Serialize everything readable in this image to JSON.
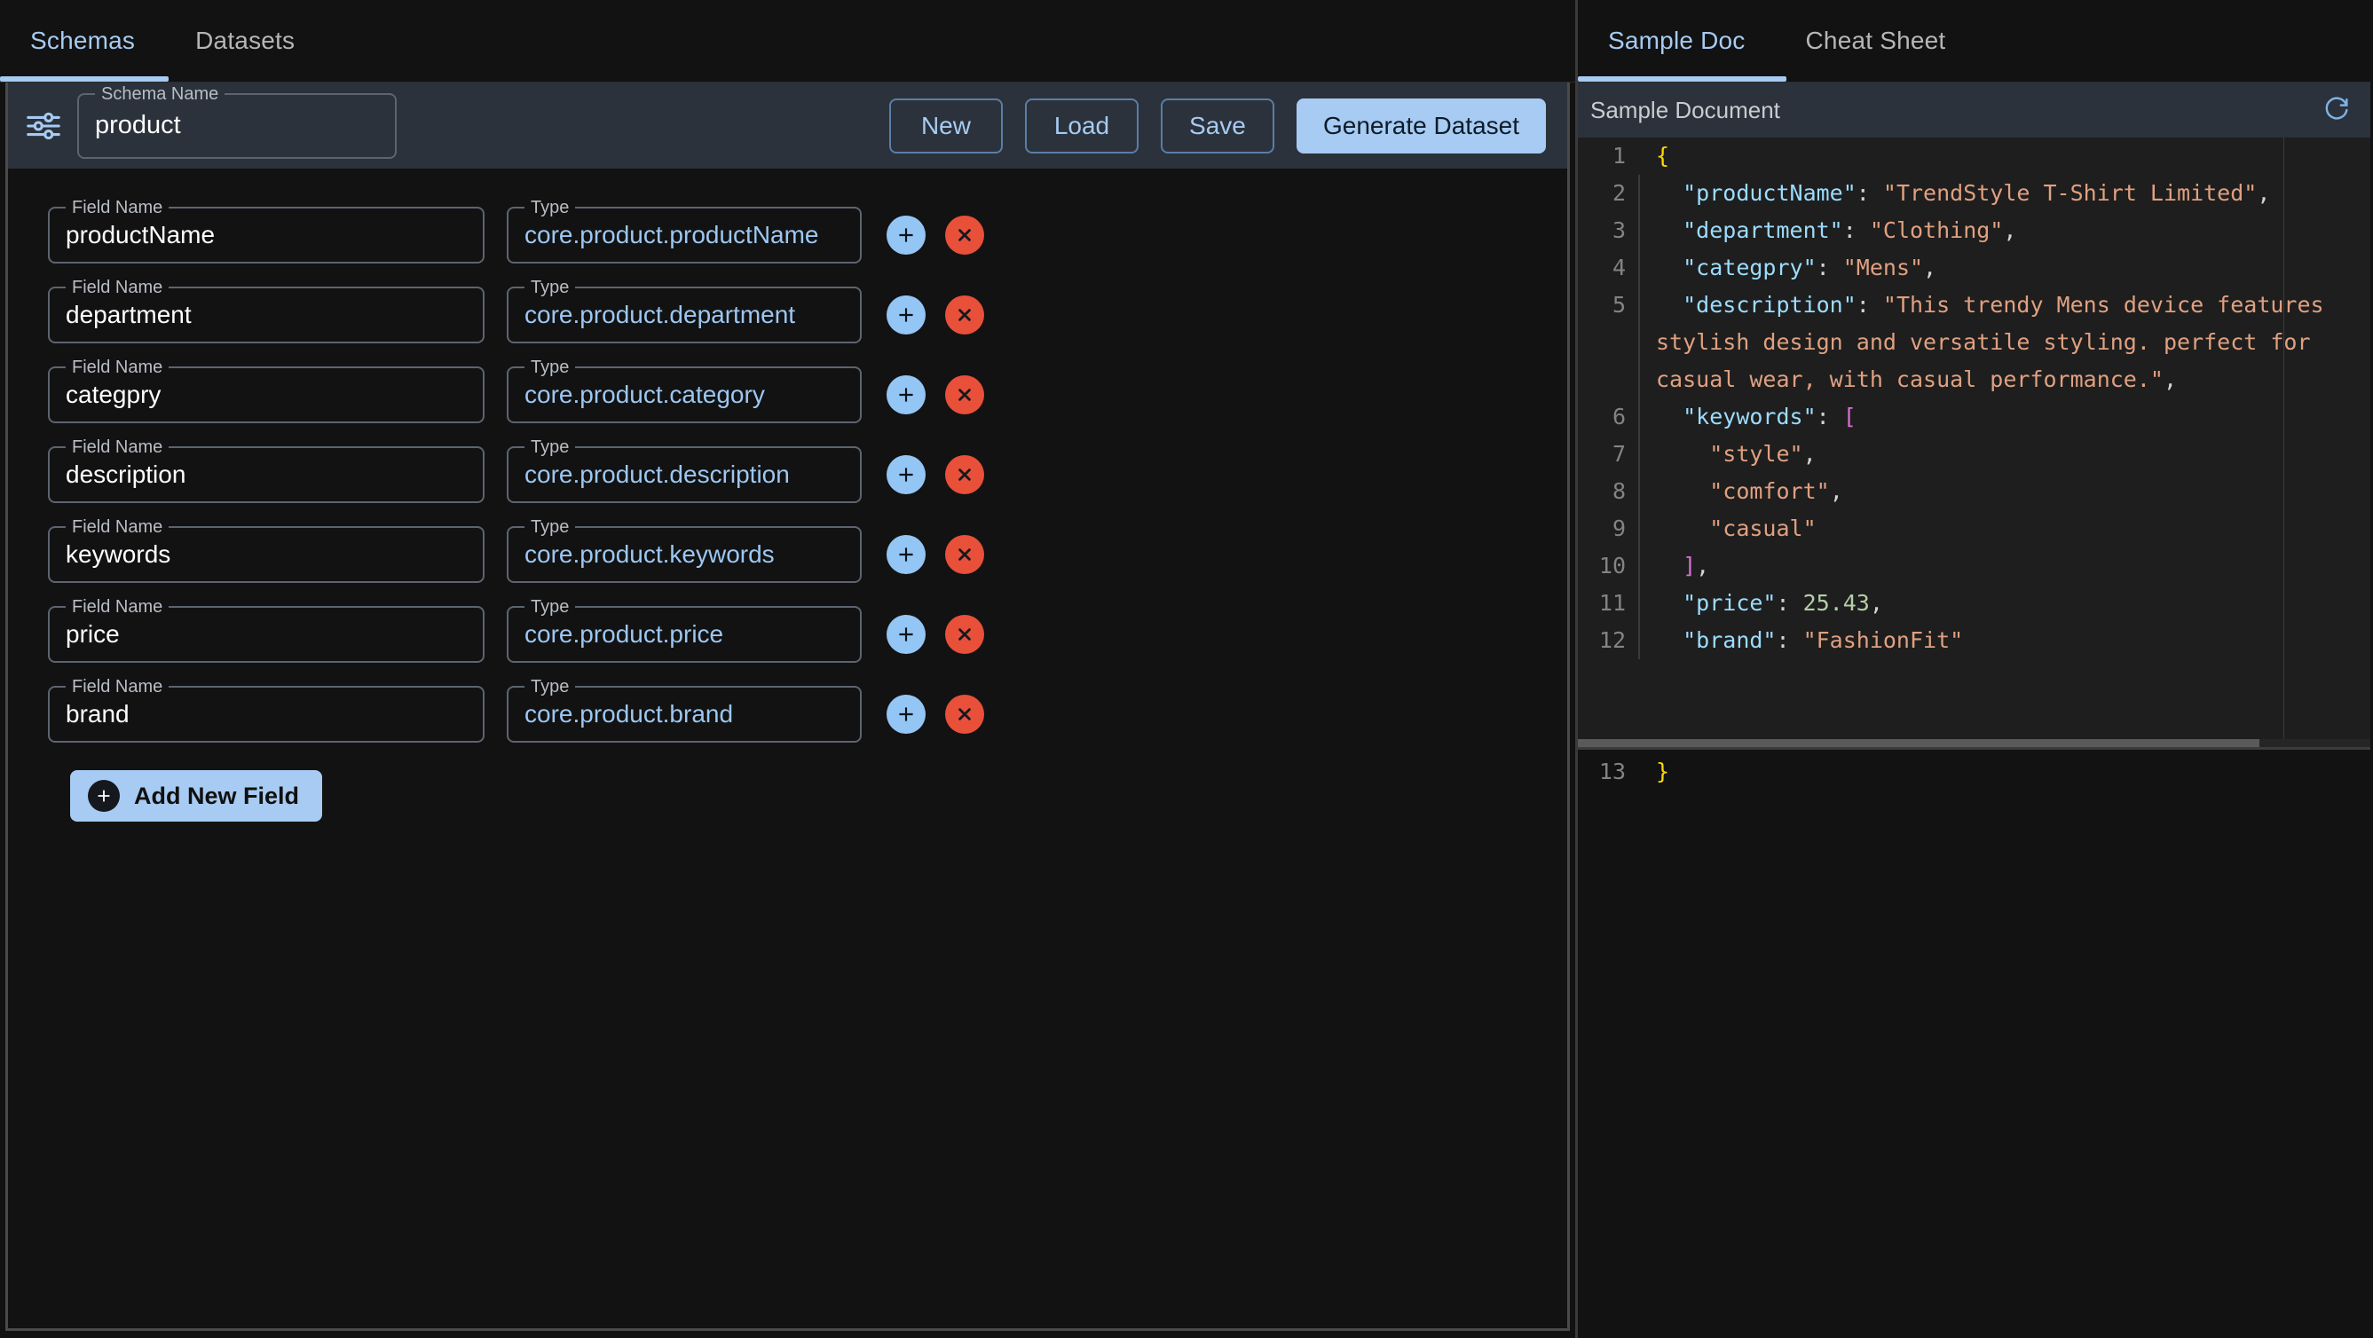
{
  "left": {
    "tabs": [
      {
        "label": "Schemas",
        "active": true
      },
      {
        "label": "Datasets",
        "active": false
      }
    ],
    "toolbar": {
      "tune_icon": "tune-icon",
      "schema_name_label": "Schema Name",
      "schema_name_value": "product",
      "buttons": [
        {
          "label": "New",
          "style": "outlined"
        },
        {
          "label": "Load",
          "style": "outlined"
        },
        {
          "label": "Save",
          "style": "outlined"
        },
        {
          "label": "Generate Dataset",
          "style": "contained"
        }
      ]
    },
    "field_name_label": "Field Name",
    "type_label": "Type",
    "fields": [
      {
        "name": "productName",
        "type": "core.product.productName"
      },
      {
        "name": "department",
        "type": "core.product.department"
      },
      {
        "name": "categpry",
        "type": "core.product.category"
      },
      {
        "name": "description",
        "type": "core.product.description"
      },
      {
        "name": "keywords",
        "type": "core.product.keywords"
      },
      {
        "name": "price",
        "type": "core.product.price"
      },
      {
        "name": "brand",
        "type": "core.product.brand"
      }
    ],
    "add_new_field_label": "Add New Field",
    "add_icon": "plus-icon",
    "delete_icon": "close-circle-icon"
  },
  "right": {
    "tabs": [
      {
        "label": "Sample Doc",
        "active": true
      },
      {
        "label": "Cheat Sheet",
        "active": false
      }
    ],
    "doc_header": {
      "title": "Sample Document",
      "refresh_icon": "refresh-icon"
    },
    "code": {
      "language": "json",
      "lines": [
        {
          "num": "1",
          "tokens": [
            {
              "t": "{",
              "c": "brace"
            }
          ]
        },
        {
          "num": "2",
          "tokens": [
            {
              "t": "  ",
              "c": "punc"
            },
            {
              "t": "\"productName\"",
              "c": "key"
            },
            {
              "t": ": ",
              "c": "punc"
            },
            {
              "t": "\"TrendStyle T-Shirt Limited\"",
              "c": "str"
            },
            {
              "t": ",",
              "c": "punc"
            }
          ]
        },
        {
          "num": "3",
          "tokens": [
            {
              "t": "  ",
              "c": "punc"
            },
            {
              "t": "\"department\"",
              "c": "key"
            },
            {
              "t": ": ",
              "c": "punc"
            },
            {
              "t": "\"Clothing\"",
              "c": "str"
            },
            {
              "t": ",",
              "c": "punc"
            }
          ]
        },
        {
          "num": "4",
          "tokens": [
            {
              "t": "  ",
              "c": "punc"
            },
            {
              "t": "\"categpry\"",
              "c": "key"
            },
            {
              "t": ": ",
              "c": "punc"
            },
            {
              "t": "\"Mens\"",
              "c": "str"
            },
            {
              "t": ",",
              "c": "punc"
            }
          ]
        },
        {
          "num": "5",
          "tokens": [
            {
              "t": "  ",
              "c": "punc"
            },
            {
              "t": "\"description\"",
              "c": "key"
            },
            {
              "t": ": ",
              "c": "punc"
            },
            {
              "t": "\"This trendy Mens device features stylish design and versatile styling. perfect for casual wear, with casual performance.\"",
              "c": "str"
            },
            {
              "t": ",",
              "c": "punc"
            }
          ]
        },
        {
          "num": "6",
          "tokens": [
            {
              "t": "  ",
              "c": "punc"
            },
            {
              "t": "\"keywords\"",
              "c": "key"
            },
            {
              "t": ": ",
              "c": "punc"
            },
            {
              "t": "[",
              "c": "bracket"
            }
          ]
        },
        {
          "num": "7",
          "tokens": [
            {
              "t": "    ",
              "c": "punc"
            },
            {
              "t": "\"style\"",
              "c": "str"
            },
            {
              "t": ",",
              "c": "punc"
            }
          ]
        },
        {
          "num": "8",
          "tokens": [
            {
              "t": "    ",
              "c": "punc"
            },
            {
              "t": "\"comfort\"",
              "c": "str"
            },
            {
              "t": ",",
              "c": "punc"
            }
          ]
        },
        {
          "num": "9",
          "tokens": [
            {
              "t": "    ",
              "c": "punc"
            },
            {
              "t": "\"casual\"",
              "c": "str"
            }
          ]
        },
        {
          "num": "10",
          "tokens": [
            {
              "t": "  ",
              "c": "punc"
            },
            {
              "t": "]",
              "c": "bracket"
            },
            {
              "t": ",",
              "c": "punc"
            }
          ]
        },
        {
          "num": "11",
          "tokens": [
            {
              "t": "  ",
              "c": "punc"
            },
            {
              "t": "\"price\"",
              "c": "key"
            },
            {
              "t": ": ",
              "c": "punc"
            },
            {
              "t": "25.43",
              "c": "num"
            },
            {
              "t": ",",
              "c": "punc"
            }
          ]
        },
        {
          "num": "12",
          "tokens": [
            {
              "t": "  ",
              "c": "punc"
            },
            {
              "t": "\"brand\"",
              "c": "key"
            },
            {
              "t": ": ",
              "c": "punc"
            },
            {
              "t": "\"FashionFit\"",
              "c": "str"
            }
          ]
        }
      ],
      "last_line": {
        "num": "13",
        "tokens": [
          {
            "t": "}",
            "c": "brace"
          }
        ]
      }
    }
  },
  "colors": {
    "accent": "#a7cbf2",
    "panel": "#2b323b",
    "background": "#121212",
    "code_bg": "#1e1e1e",
    "delete": "#e8503a",
    "add": "#93c5f5"
  }
}
